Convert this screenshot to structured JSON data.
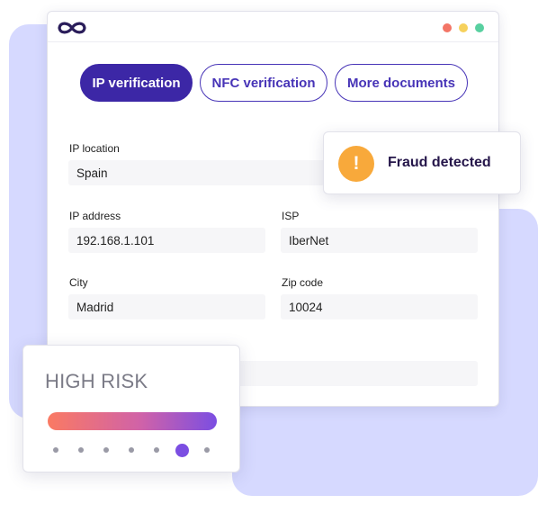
{
  "titlebar": {
    "logo_icon": "infinity-logo-icon",
    "window_dots": [
      "#f37566",
      "#f6d15c",
      "#58d0a0"
    ]
  },
  "tabs": [
    {
      "label": "IP verification",
      "active": true
    },
    {
      "label": "NFC verification",
      "active": false
    },
    {
      "label": "More documents",
      "active": false
    }
  ],
  "form": {
    "ip_location": {
      "label": "IP location",
      "value": "Spain"
    },
    "ip_address": {
      "label": "IP address",
      "value": "192.168.1.101"
    },
    "isp": {
      "label": "ISP",
      "value": "IberNet"
    },
    "city": {
      "label": "City",
      "value": "Madrid"
    },
    "zip_code": {
      "label": "Zip code",
      "value": "10024"
    }
  },
  "alert": {
    "icon": "warning-icon",
    "icon_glyph": "!",
    "text": "Fraud detected",
    "color": "#f8a93b"
  },
  "risk": {
    "title": "HIGH RISK",
    "level": 6,
    "max_level": 7,
    "gradient": [
      "#fa7a63",
      "#d062a8",
      "#7b4ee2"
    ]
  },
  "colors": {
    "accent": "#3c27a6",
    "background_shape": "#d6d9ff"
  }
}
